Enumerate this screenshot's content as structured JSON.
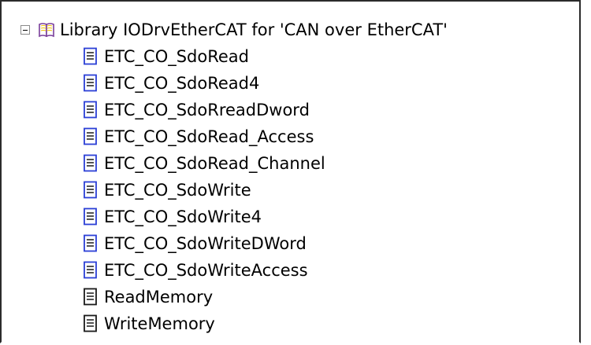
{
  "tree": {
    "root": {
      "label": "Library IODrvEtherCAT for 'CAN over EtherCAT'",
      "expanded": true,
      "icon": "library-book-icon"
    },
    "children": [
      {
        "label": "ETC_CO_SdoRead",
        "icon": "document-icon"
      },
      {
        "label": "ETC_CO_SdoRead4",
        "icon": "document-icon"
      },
      {
        "label": "ETC_CO_SdoRreadDword",
        "icon": "document-icon"
      },
      {
        "label": "ETC_CO_SdoRead_Access",
        "icon": "document-icon"
      },
      {
        "label": "ETC_CO_SdoRead_Channel",
        "icon": "document-icon"
      },
      {
        "label": "ETC_CO_SdoWrite",
        "icon": "document-icon"
      },
      {
        "label": "ETC_CO_SdoWrite4",
        "icon": "document-icon"
      },
      {
        "label": "ETC_CO_SdoWriteDWord",
        "icon": "document-icon"
      },
      {
        "label": "ETC_CO_SdoWriteAccess",
        "icon": "document-icon"
      },
      {
        "label": "ReadMemory",
        "icon": "document-icon"
      },
      {
        "label": "WriteMemory",
        "icon": "document-icon"
      }
    ]
  },
  "colors": {
    "book_purple": "#7a3f9a",
    "doc_blue": "#2b3fd6",
    "border": "#2b2b2b"
  }
}
